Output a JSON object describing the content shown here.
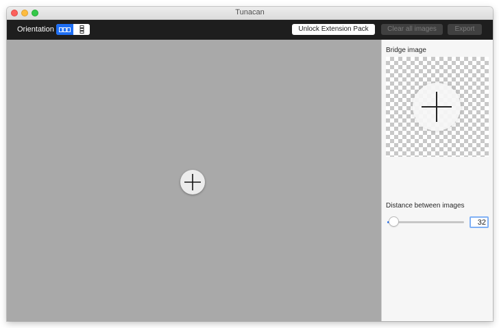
{
  "window": {
    "title": "Tunacan"
  },
  "toolbar": {
    "orientation_label": "Orientation",
    "orientation_options": [
      "horizontal",
      "vertical"
    ],
    "orientation_selected": "horizontal",
    "unlock_label": "Unlock Extension Pack",
    "clear_label": "Clear all images",
    "export_label": "Export"
  },
  "canvas": {
    "add_icon": "plus-icon"
  },
  "sidebar": {
    "bridge_label": "Bridge image",
    "bridge_add_icon": "plus-icon",
    "distance_label": "Distance between images",
    "distance_value": "32"
  },
  "colors": {
    "toolbar_bg": "#1e1e1e",
    "canvas_bg": "#a9a9a9",
    "accent": "#1e6ff5"
  }
}
